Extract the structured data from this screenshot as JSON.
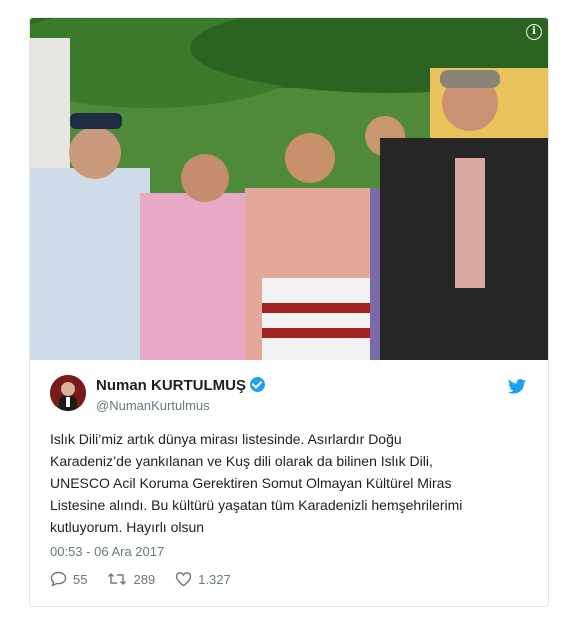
{
  "media": {
    "info_icon": "info-icon",
    "colors": {
      "hillside": "#3f7a2e",
      "pink_blouse": "#e6a9c8",
      "jacket": "#2b2b2b"
    }
  },
  "author": {
    "display_name": "Numan KURTULMUŞ",
    "handle": "@NumanKurtulmus",
    "verified_icon": "verified-badge-icon"
  },
  "brand": {
    "icon": "twitter-bird-icon",
    "color": "#1da1f2"
  },
  "tweet": {
    "lines": [
      "Islık Dili’miz artık dünya mirası listesinde. Asırlardır Doğu",
      "Karadeniz’de yankılanan ve Kuş dili olarak da bilinen Islık Dili,",
      "UNESCO Acil Koruma Gerektiren Somut Olmayan Kültürel Miras",
      "Listesine alındı. Bu kültürü yaşatan tüm Karadenizli hemşehrilerimi",
      "kutluyorum. Hayırlı olsun"
    ],
    "timestamp": "00:53 - 06 Ara 2017"
  },
  "actions": {
    "reply_count": "55",
    "retweet_count": "289",
    "like_count": "1.327"
  }
}
